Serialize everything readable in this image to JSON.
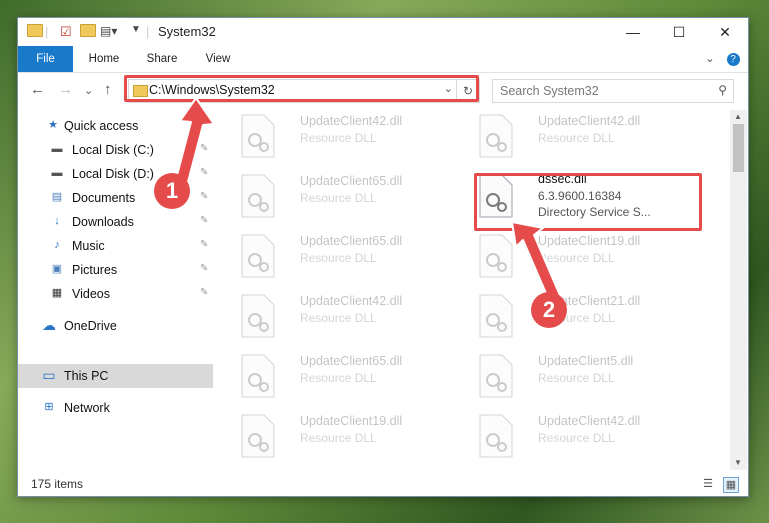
{
  "titlebar": {
    "title": "System32",
    "controls": {
      "minimize": "—",
      "maximize": "☐",
      "close": "✕"
    }
  },
  "ribbon": {
    "tabs": [
      "File",
      "Home",
      "Share",
      "View"
    ],
    "expand": "⌄",
    "help": "?"
  },
  "navigation": {
    "back": "←",
    "forward": "→",
    "recent": "⌄",
    "up": "↑",
    "address": "C:\\Windows\\System32",
    "address_dropdown": "⌄",
    "refresh": "↻",
    "search_placeholder": "Search System32",
    "search_icon": "⚲"
  },
  "sidebar": {
    "items": [
      {
        "label": "Quick access",
        "icon": "star-icon",
        "glyph": "★",
        "color": "#2f6fc0",
        "pinned": false
      },
      {
        "label": "Local Disk (C:)",
        "icon": "drive-icon",
        "glyph": "▬",
        "color": "#555555",
        "pinned": true
      },
      {
        "label": "Local Disk (D:)",
        "icon": "drive-icon",
        "glyph": "▬",
        "color": "#555555",
        "pinned": true
      },
      {
        "label": "Documents",
        "icon": "documents-icon",
        "glyph": "▤",
        "color": "#4a7fb8",
        "pinned": true
      },
      {
        "label": "Downloads",
        "icon": "download-icon",
        "glyph": "↓",
        "color": "#2a74c8",
        "pinned": true
      },
      {
        "label": "Music",
        "icon": "music-icon",
        "glyph": "♪",
        "color": "#2a74c8",
        "pinned": true
      },
      {
        "label": "Pictures",
        "icon": "pictures-icon",
        "glyph": "▣",
        "color": "#4a7fb8",
        "pinned": true
      },
      {
        "label": "Videos",
        "icon": "videos-icon",
        "glyph": "▦",
        "color": "#333333",
        "pinned": true
      },
      {
        "label": "OneDrive",
        "icon": "cloud-icon",
        "glyph": "☁",
        "color": "#2a74c8",
        "pinned": false
      },
      {
        "label": "This PC",
        "icon": "computer-icon",
        "glyph": "▭",
        "color": "#2a74c8",
        "pinned": false
      },
      {
        "label": "Network",
        "icon": "network-icon",
        "glyph": "⊞",
        "color": "#2a74c8",
        "pinned": false
      }
    ],
    "pin_glyph": "✎"
  },
  "files": [
    {
      "name": "UpdateClient42.dll",
      "desc": "Resource DLL"
    },
    {
      "name": "UpdateClient42.dll",
      "desc": "Resource DLL"
    },
    {
      "name": "UpdateClient65.dll",
      "desc": "Resource DLL"
    },
    {
      "name": "dssec.dll",
      "version": "6.3.9600.16384",
      "desc": "Directory Service S..."
    },
    {
      "name": "UpdateClient65.dll",
      "desc": "Resource DLL"
    },
    {
      "name": "UpdateClient19.dll",
      "desc": "Resource DLL"
    },
    {
      "name": "UpdateClient42.dll",
      "desc": "Resource DLL"
    },
    {
      "name": "UpdateClient21.dll",
      "desc": "Resource DLL"
    },
    {
      "name": "UpdateClient65.dll",
      "desc": "Resource DLL"
    },
    {
      "name": "UpdateClient5.dll",
      "desc": "Resource DLL"
    },
    {
      "name": "UpdateClient19.dll",
      "desc": "Resource DLL"
    },
    {
      "name": "UpdateClient42.dll",
      "desc": "Resource DLL"
    }
  ],
  "status": {
    "item_count": "175 items"
  },
  "annotations": {
    "step1": "1",
    "step2": "2",
    "color": "#e64b4b"
  }
}
